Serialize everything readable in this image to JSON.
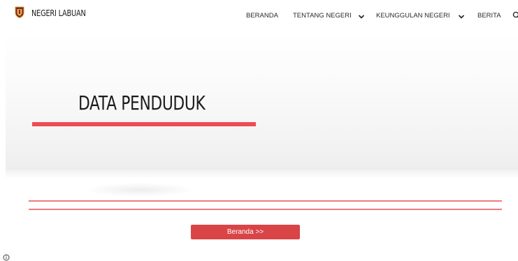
{
  "header": {
    "brand": "NEGERI LABUAN",
    "logo": "shield-emblem",
    "nav": [
      {
        "label": "BERANDA",
        "dropdown": false
      },
      {
        "label": "TENTANG NEGERI",
        "dropdown": true
      },
      {
        "label": "KEUNGGULAN NEGERI",
        "dropdown": true
      },
      {
        "label": "BERITA",
        "dropdown": false
      }
    ],
    "search_icon": "search-icon"
  },
  "hero": {
    "title": "DATA PENDUDUK"
  },
  "main": {
    "button_label": "Beranda >>"
  },
  "footer": {
    "info_icon": "info-icon"
  },
  "colors": {
    "accent": "#ee4b52",
    "button": "#d94447",
    "rule": "#f07a7c"
  }
}
